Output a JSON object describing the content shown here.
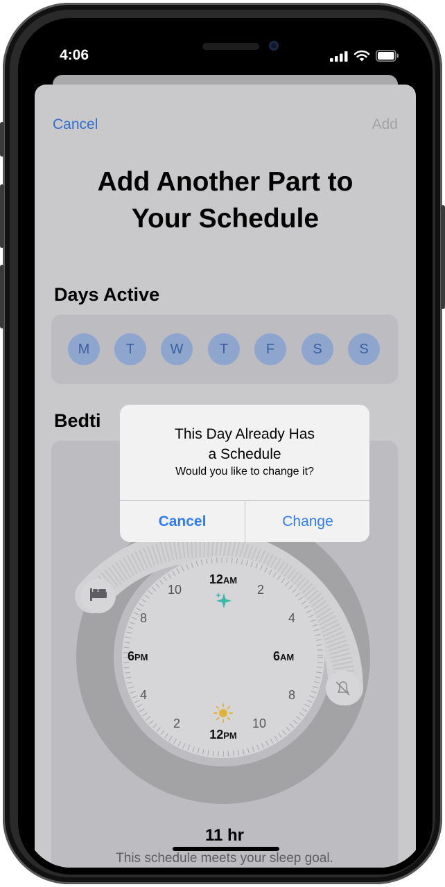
{
  "status_bar": {
    "time": "4:06"
  },
  "nav": {
    "cancel_label": "Cancel",
    "add_label": "Add"
  },
  "title_lines": [
    "Add Another Part to",
    "Your Schedule"
  ],
  "days_active": {
    "heading": "Days Active",
    "days": [
      "M",
      "T",
      "W",
      "T",
      "F",
      "S",
      "S"
    ]
  },
  "bedtime": {
    "heading_partial": "Bedti"
  },
  "clock": {
    "top_label": "12",
    "top_suffix": "AM",
    "bottom_label": "12",
    "bottom_suffix": "PM",
    "left_label": "6",
    "left_suffix": "PM",
    "right_label": "6",
    "right_suffix": "AM",
    "numbers": [
      "10",
      "2",
      "8",
      "4",
      "4",
      "8",
      "2",
      "10"
    ]
  },
  "summary": {
    "duration": "11 hr",
    "note": "This schedule meets your sleep goal."
  },
  "alert": {
    "title_lines": [
      "This Day Already Has",
      "a Schedule"
    ],
    "message": "Would you like to change it?",
    "cancel_label": "Cancel",
    "change_label": "Change"
  },
  "colors": {
    "accent_blue": "#2f7cf6",
    "sparkle_teal": "#3bb9a8",
    "sun_yellow": "#e0b43a"
  }
}
